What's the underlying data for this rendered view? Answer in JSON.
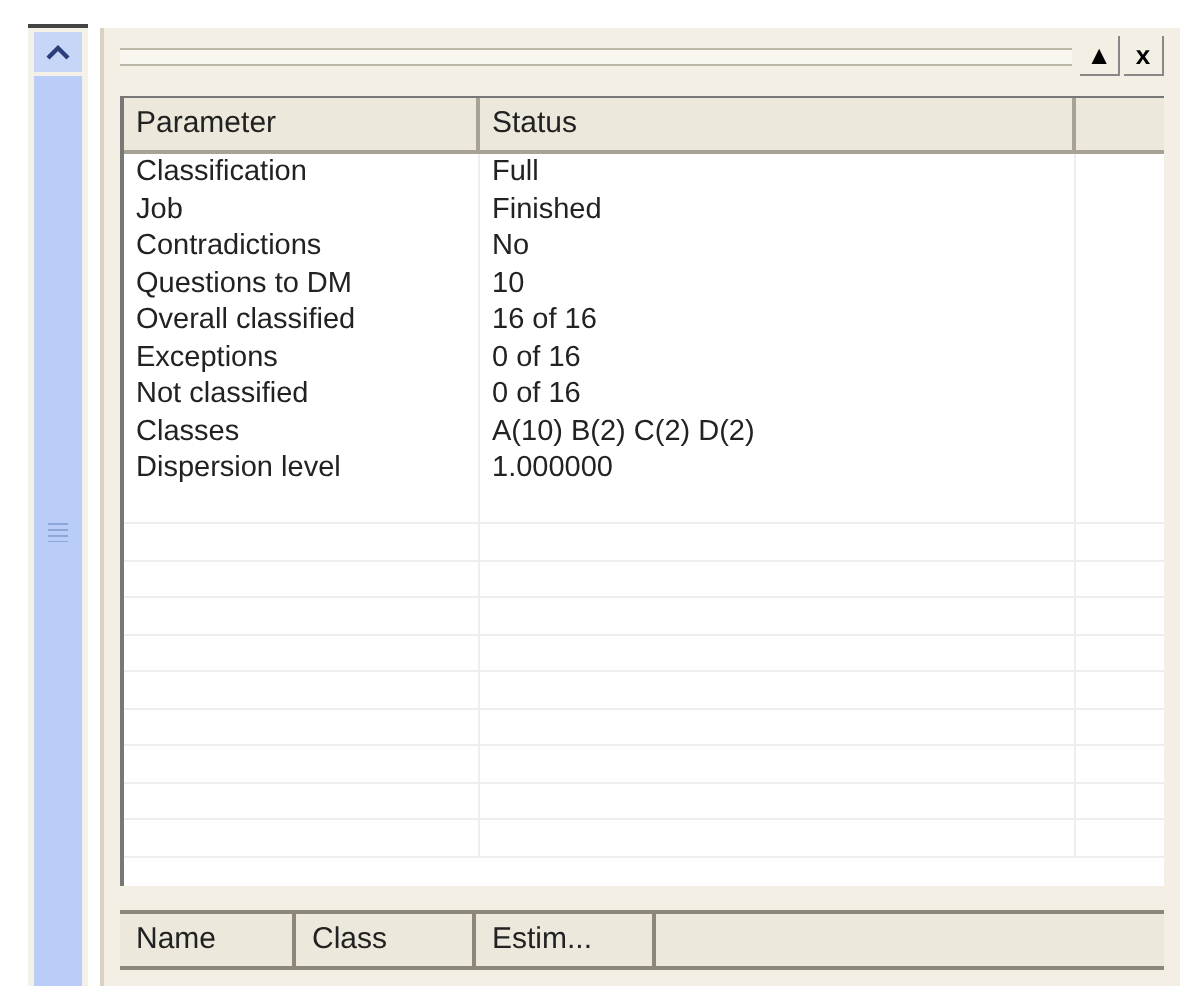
{
  "panel": {
    "buttons": [
      "▲",
      "x"
    ]
  },
  "parameters_table": {
    "columns": [
      "Parameter",
      "Status"
    ],
    "rows": [
      {
        "parameter": "Classification",
        "status": "Full"
      },
      {
        "parameter": "Job",
        "status": "Finished"
      },
      {
        "parameter": "Contradictions",
        "status": "No"
      },
      {
        "parameter": "Questions to DM",
        "status": "10"
      },
      {
        "parameter": "Overall classified",
        "status": "16 of 16"
      },
      {
        "parameter": "Exceptions",
        "status": "0 of 16"
      },
      {
        "parameter": "Not classified",
        "status": "0 of 16"
      },
      {
        "parameter": "Classes",
        "status": "A(10) B(2) C(2) D(2)"
      },
      {
        "parameter": "Dispersion level",
        "status": "1.000000"
      }
    ]
  },
  "objects_table": {
    "columns": [
      "Name",
      "Class",
      "Estim..."
    ]
  }
}
